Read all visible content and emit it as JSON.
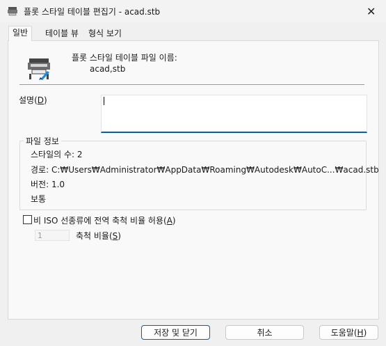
{
  "window": {
    "title": "플롯 스타일 테이블 편집기 - acad.stb",
    "close_glyph": "✕"
  },
  "tabs": [
    {
      "label": "일반"
    },
    {
      "label": "테이블 뷰"
    },
    {
      "label": "형식 보기"
    }
  ],
  "header": {
    "filename_label": "플롯 스타일 테이블 파일 이름:",
    "filename_value": "acad,stb"
  },
  "description": {
    "label_prefix": "설명(",
    "label_key": "D",
    "label_suffix": ")",
    "value": ""
  },
  "file_info": {
    "legend": "파일 정보",
    "style_count": "스타일의 수: 2",
    "path": "경로: C:₩Users₩Administrator₩AppData₩Roaming₩Autodesk₩AutoC...₩acad.stb",
    "version": "버전: 1.0",
    "extra": "보통"
  },
  "scale_option": {
    "checkbox_prefix": "비 ISO 선종류에 전역 축척 비율 허용(",
    "checkbox_key": "A",
    "checkbox_suffix": ")",
    "checked": false,
    "scale_value": "1",
    "scale_label_prefix": "축척 비율(",
    "scale_label_key": "S",
    "scale_label_suffix": ")"
  },
  "buttons": {
    "save_close": "저장 및 닫기",
    "cancel": "취소",
    "help_prefix": "도움말(",
    "help_key": "H",
    "help_suffix": ")"
  },
  "colors": {
    "accent": "#005fb8",
    "panel": "#f9f9f9",
    "background": "#f0f0f0"
  }
}
